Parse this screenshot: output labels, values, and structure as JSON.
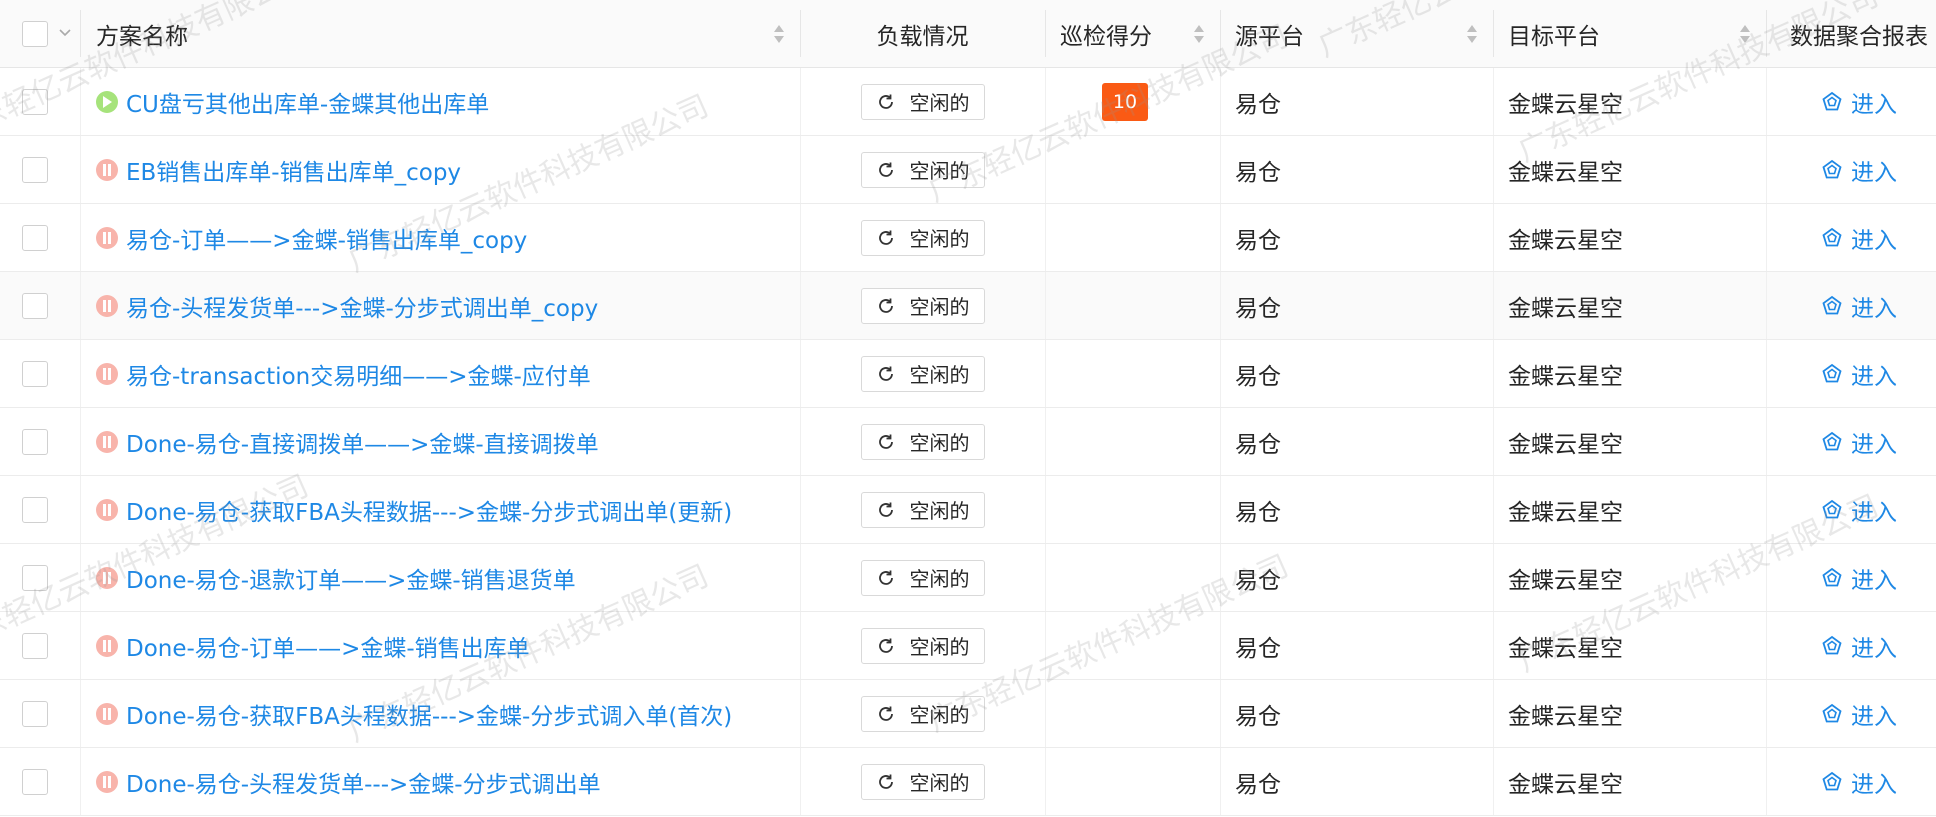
{
  "header": {
    "name": "方案名称",
    "load": "负载情况",
    "score": "巡检得分",
    "source": "源平台",
    "target": "目标平台",
    "report": "数据聚合报表"
  },
  "rows": [
    {
      "status": "running",
      "name": "CU盘亏其他出库单-金蝶其他出库单",
      "load": "空闲的",
      "score": "10",
      "source": "易仓",
      "target": "金蝶云星空",
      "report": "进入"
    },
    {
      "status": "paused",
      "name": "EB销售出库单-销售出库单_copy",
      "load": "空闲的",
      "score": "",
      "source": "易仓",
      "target": "金蝶云星空",
      "report": "进入"
    },
    {
      "status": "paused",
      "name": "易仓-订单——>金蝶-销售出库单_copy",
      "load": "空闲的",
      "score": "",
      "source": "易仓",
      "target": "金蝶云星空",
      "report": "进入"
    },
    {
      "status": "paused",
      "name": "易仓-头程发货单--->金蝶-分步式调出单_copy",
      "load": "空闲的",
      "score": "",
      "source": "易仓",
      "target": "金蝶云星空",
      "report": "进入"
    },
    {
      "status": "paused",
      "name": "易仓-transaction交易明细——>金蝶-应付单",
      "load": "空闲的",
      "score": "",
      "source": "易仓",
      "target": "金蝶云星空",
      "report": "进入"
    },
    {
      "status": "paused",
      "name": "Done-易仓-直接调拨单——>金蝶-直接调拨单",
      "load": "空闲的",
      "score": "",
      "source": "易仓",
      "target": "金蝶云星空",
      "report": "进入"
    },
    {
      "status": "paused",
      "name": "Done-易仓-获取FBA头程数据--->金蝶-分步式调出单(更新)",
      "load": "空闲的",
      "score": "",
      "source": "易仓",
      "target": "金蝶云星空",
      "report": "进入"
    },
    {
      "status": "paused",
      "name": "Done-易仓-退款订单——>金蝶-销售退货单",
      "load": "空闲的",
      "score": "",
      "source": "易仓",
      "target": "金蝶云星空",
      "report": "进入"
    },
    {
      "status": "paused",
      "name": "Done-易仓-订单——>金蝶-销售出库单",
      "load": "空闲的",
      "score": "",
      "source": "易仓",
      "target": "金蝶云星空",
      "report": "进入"
    },
    {
      "status": "paused",
      "name": "Done-易仓-获取FBA头程数据--->金蝶-分步式调入单(首次)",
      "load": "空闲的",
      "score": "",
      "source": "易仓",
      "target": "金蝶云星空",
      "report": "进入"
    },
    {
      "status": "paused",
      "name": "Done-易仓-头程发货单--->金蝶-分步式调出单",
      "load": "空闲的",
      "score": "",
      "source": "易仓",
      "target": "金蝶云星空",
      "report": "进入"
    }
  ],
  "watermark": "广东轻亿云软件科技有限公司",
  "colors": {
    "link": "#1e88e5",
    "score_badge": "#fa5a14",
    "running": "#a6e37b",
    "paused": "#f8b4ab"
  }
}
